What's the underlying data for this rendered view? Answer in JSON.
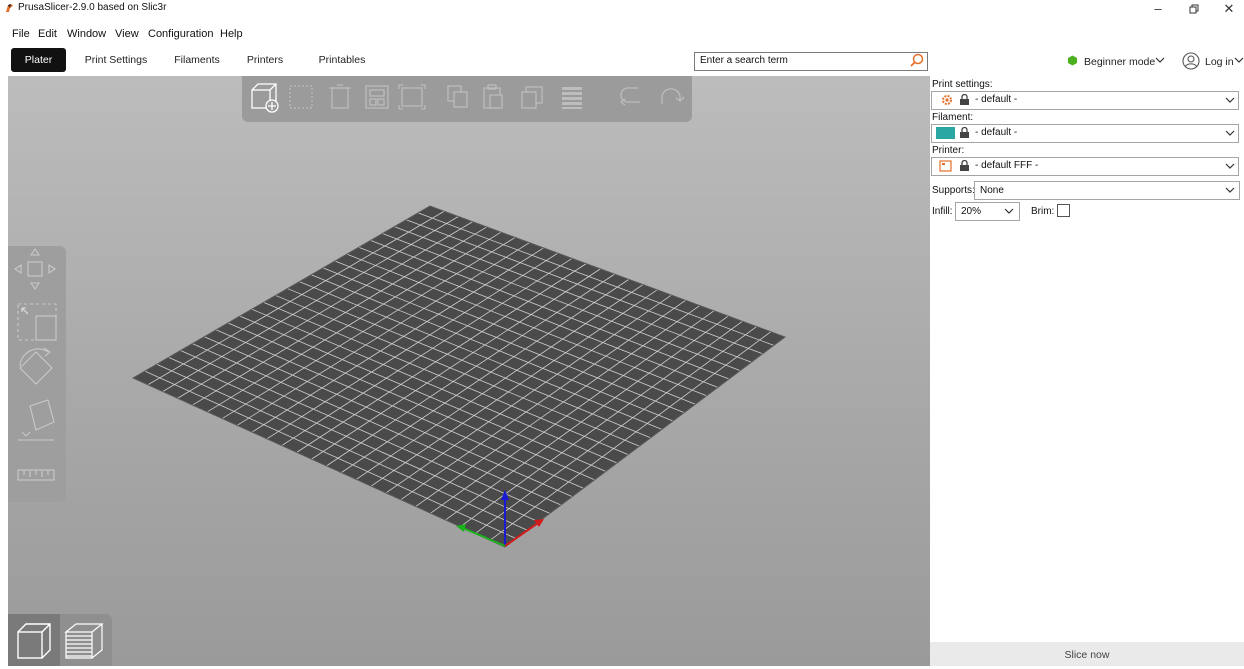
{
  "window": {
    "title": "PrusaSlicer-2.9.0 based on Slic3r"
  },
  "menu": [
    "File",
    "Edit",
    "Window",
    "View",
    "Configuration",
    "Help"
  ],
  "tabs": [
    "Plater",
    "Print Settings",
    "Filaments",
    "Printers",
    "Printables"
  ],
  "active_tab": "Plater",
  "search": {
    "placeholder": "Enter a search term"
  },
  "mode": {
    "label": "Beginner mode",
    "color": "#4caf1e"
  },
  "account": {
    "label": "Log in"
  },
  "sidebar": {
    "print_settings_label": "Print settings:",
    "print_settings_value": "- default -",
    "filament_label": "Filament:",
    "filament_value": "- default -",
    "filament_color": "#2aa7a2",
    "printer_label": "Printer:",
    "printer_value": "- default FFF -",
    "supports_label": "Supports:",
    "supports_value": "None",
    "infill_label": "Infill:",
    "infill_value": "20%",
    "brim_label": "Brim:",
    "brim_checked": false
  },
  "slice_button": {
    "label": "Slice now"
  },
  "colors": {
    "bed": "#4a4a4a",
    "grid": "#ffffff",
    "x_axis": "#d31b1b",
    "y_axis": "#1ab21a",
    "z_axis": "#1a1ad6"
  },
  "icons": {
    "top_toolbar": [
      "add-icon",
      "delete-icon",
      "delete-all-icon",
      "arrange-icon",
      "arrange-selection-icon",
      "copy-icon",
      "paste-icon",
      "add-instance-icon",
      "split-icon",
      "undo-icon",
      "redo-icon"
    ],
    "left_toolbar": [
      "move-icon",
      "scale-icon",
      "rotate-icon",
      "place-on-face-icon",
      "measure-icon"
    ],
    "view_toggle": [
      "3d-view-icon",
      "preview-icon"
    ]
  }
}
